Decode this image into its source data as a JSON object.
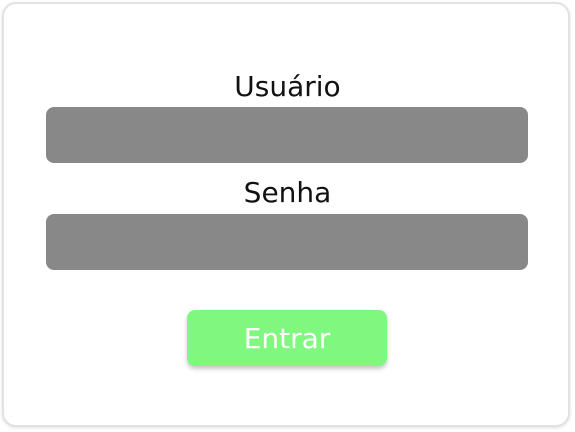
{
  "form": {
    "username_label": "Usuário",
    "username_value": "",
    "password_label": "Senha",
    "password_value": "",
    "submit_label": "Entrar"
  },
  "colors": {
    "input_background": "#888888",
    "button_background": "#80f880",
    "text": "#111111",
    "card_border": "#e2e2e2"
  }
}
